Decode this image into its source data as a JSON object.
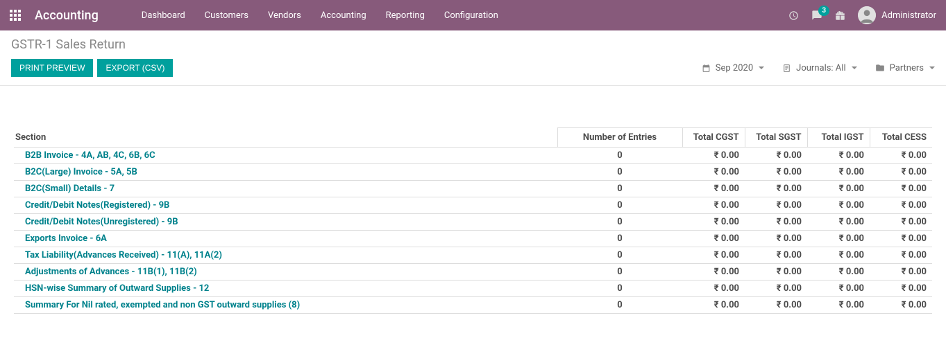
{
  "header": {
    "app_name": "Accounting",
    "menu": [
      "Dashboard",
      "Customers",
      "Vendors",
      "Accounting",
      "Reporting",
      "Configuration"
    ],
    "message_count": "3",
    "username": "Administrator"
  },
  "control_panel": {
    "breadcrumb": "GSTR-1 Sales Return",
    "btn_print": "PRINT PREVIEW",
    "btn_export": "EXPORT (CSV)",
    "filter_date": "Sep 2020",
    "filter_journals": "Journals: All",
    "filter_partners": "Partners"
  },
  "table": {
    "columns": {
      "section": "Section",
      "entries": "Number of Entries",
      "cgst": "Total CGST",
      "sgst": "Total SGST",
      "igst": "Total IGST",
      "cess": "Total CESS"
    },
    "currency": "₹",
    "rows": [
      {
        "section": "B2B Invoice - 4A, AB, 4C, 6B, 6C",
        "entries": "0",
        "cgst": "0.00",
        "sgst": "0.00",
        "igst": "0.00",
        "cess": "0.00"
      },
      {
        "section": "B2C(Large) Invoice - 5A, 5B",
        "entries": "0",
        "cgst": "0.00",
        "sgst": "0.00",
        "igst": "0.00",
        "cess": "0.00"
      },
      {
        "section": "B2C(Small) Details - 7",
        "entries": "0",
        "cgst": "0.00",
        "sgst": "0.00",
        "igst": "0.00",
        "cess": "0.00"
      },
      {
        "section": "Credit/Debit Notes(Registered) - 9B",
        "entries": "0",
        "cgst": "0.00",
        "sgst": "0.00",
        "igst": "0.00",
        "cess": "0.00"
      },
      {
        "section": "Credit/Debit Notes(Unregistered) - 9B",
        "entries": "0",
        "cgst": "0.00",
        "sgst": "0.00",
        "igst": "0.00",
        "cess": "0.00"
      },
      {
        "section": "Exports Invoice - 6A",
        "entries": "0",
        "cgst": "0.00",
        "sgst": "0.00",
        "igst": "0.00",
        "cess": "0.00"
      },
      {
        "section": "Tax Liability(Advances Received) - 11(A), 11A(2)",
        "entries": "0",
        "cgst": "0.00",
        "sgst": "0.00",
        "igst": "0.00",
        "cess": "0.00"
      },
      {
        "section": "Adjustments of Advances - 11B(1), 11B(2)",
        "entries": "0",
        "cgst": "0.00",
        "sgst": "0.00",
        "igst": "0.00",
        "cess": "0.00"
      },
      {
        "section": "HSN-wise Summary of Outward Supplies - 12",
        "entries": "0",
        "cgst": "0.00",
        "sgst": "0.00",
        "igst": "0.00",
        "cess": "0.00"
      },
      {
        "section": "Summary For Nil rated, exempted and non GST outward supplies (8)",
        "entries": "0",
        "cgst": "0.00",
        "sgst": "0.00",
        "igst": "0.00",
        "cess": "0.00"
      }
    ]
  }
}
